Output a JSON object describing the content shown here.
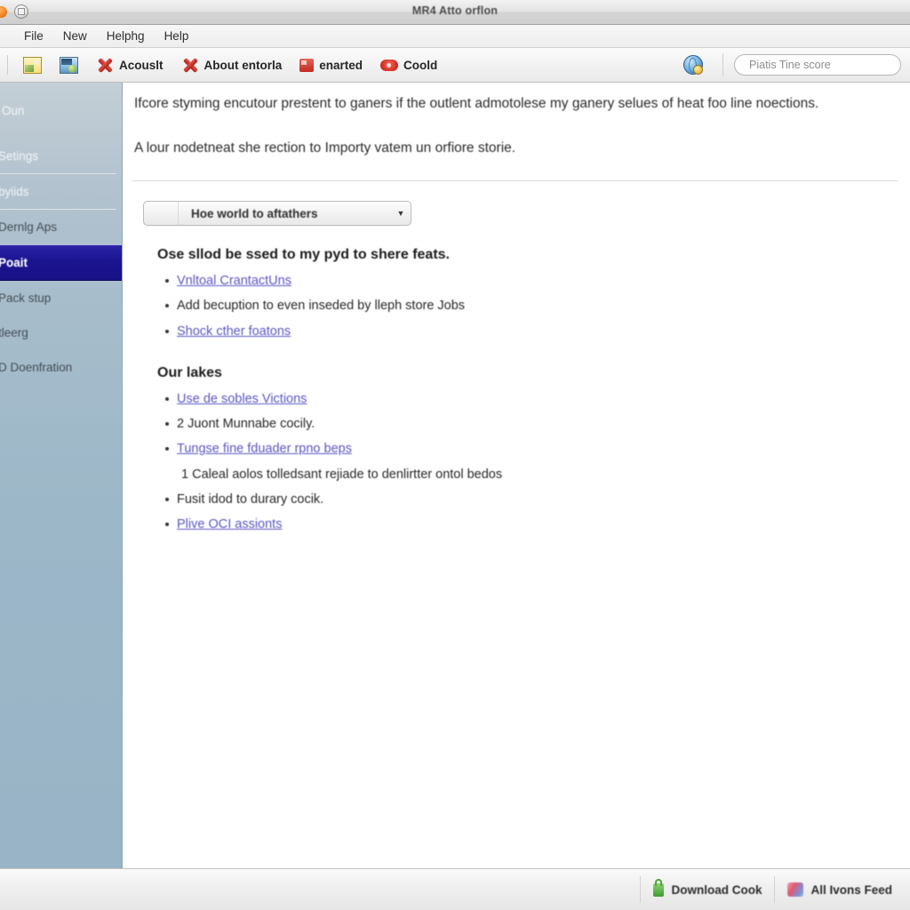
{
  "window": {
    "title": "MR4 Atto orflon",
    "controls": [
      "close-dot",
      "minimize-dot"
    ]
  },
  "menubar": {
    "items": [
      {
        "label": "File"
      },
      {
        "label": "New"
      },
      {
        "label": "Helphg"
      },
      {
        "label": "Help"
      }
    ]
  },
  "toolbar": {
    "buttons": [
      {
        "label": "",
        "icon": "picture-yellow-icon"
      },
      {
        "label": "",
        "icon": "picture-blue-icon"
      },
      {
        "label": "Acouslt",
        "icon": "red-x-icon"
      },
      {
        "label": "About entorla",
        "icon": "red-x-icon"
      },
      {
        "label": "enarted",
        "icon": "red-square-icon"
      },
      {
        "label": "Coold",
        "icon": "red-pill-icon"
      }
    ],
    "globe_icon": "globe-icon",
    "search": {
      "placeholder": "Piatis Tine score",
      "value": ""
    }
  },
  "sidebar": {
    "items": [
      {
        "label": "Oun",
        "selected": false,
        "style": "light"
      },
      {
        "label": "Setings",
        "selected": false,
        "style": "light"
      },
      {
        "label": "byiids",
        "selected": false,
        "style": "light"
      },
      {
        "label": "Dernlg Aps",
        "selected": false,
        "style": "dark"
      },
      {
        "label": "Poait",
        "selected": true,
        "style": "selected"
      },
      {
        "label": "Pack stup",
        "selected": false,
        "style": "dark"
      },
      {
        "label": "tleerg",
        "selected": false,
        "style": "dark"
      },
      {
        "label": "D Doenfration",
        "selected": false,
        "style": "dark"
      }
    ]
  },
  "content": {
    "paragraph_1": "Ifcore styming encutour prestent to ganers if the outlent admotolese my ganery selues of heat foo line noections.",
    "paragraph_2": "A lour nodetneat she rection to Importy vatem un orfiore storie.",
    "dropdown": {
      "value": "Hoe world to aftathers",
      "arrow": "chevron-down-icon"
    },
    "section_1": {
      "heading": "Ose sllod be ssed to my pyd to shere feats.",
      "items": [
        {
          "text": "Vnltoal CrantactUns",
          "link": true,
          "bullet": true
        },
        {
          "text": "Add becuption to even inseded by lleph store Jobs",
          "link": false,
          "bullet": true
        },
        {
          "text": "Shock cther foatons",
          "link": true,
          "bullet": true
        }
      ]
    },
    "section_2": {
      "heading": "Our lakes",
      "items": [
        {
          "text": "Use de sobles Victions",
          "link": true,
          "bullet": true
        },
        {
          "text": "2 Juont Munnabe cocily.",
          "link": false,
          "bullet": true
        },
        {
          "text": "Tungse fine fduader rpno beps",
          "link": true,
          "bullet": true
        },
        {
          "text": "1 Caleal aolos tolledsant rejiade to denlirtter ontol bedos",
          "link": false,
          "bullet": false
        },
        {
          "text": "Fusit idod to durary cocik.",
          "link": false,
          "bullet": true
        },
        {
          "text": "Plive OCI assionts",
          "link": true,
          "bullet": true
        }
      ]
    }
  },
  "statusbar": {
    "cells": [
      {
        "label": "Download Cook",
        "icon": "green-lock-icon"
      },
      {
        "label": "All Ivons Feed",
        "icon": "feed-icon"
      }
    ]
  },
  "colors": {
    "sidebar_top": "#c4cfd6",
    "sidebar_bottom": "#98b4c6",
    "selection": "#1b1490",
    "link": "#5a56c4",
    "accent_red": "#c02a20"
  }
}
